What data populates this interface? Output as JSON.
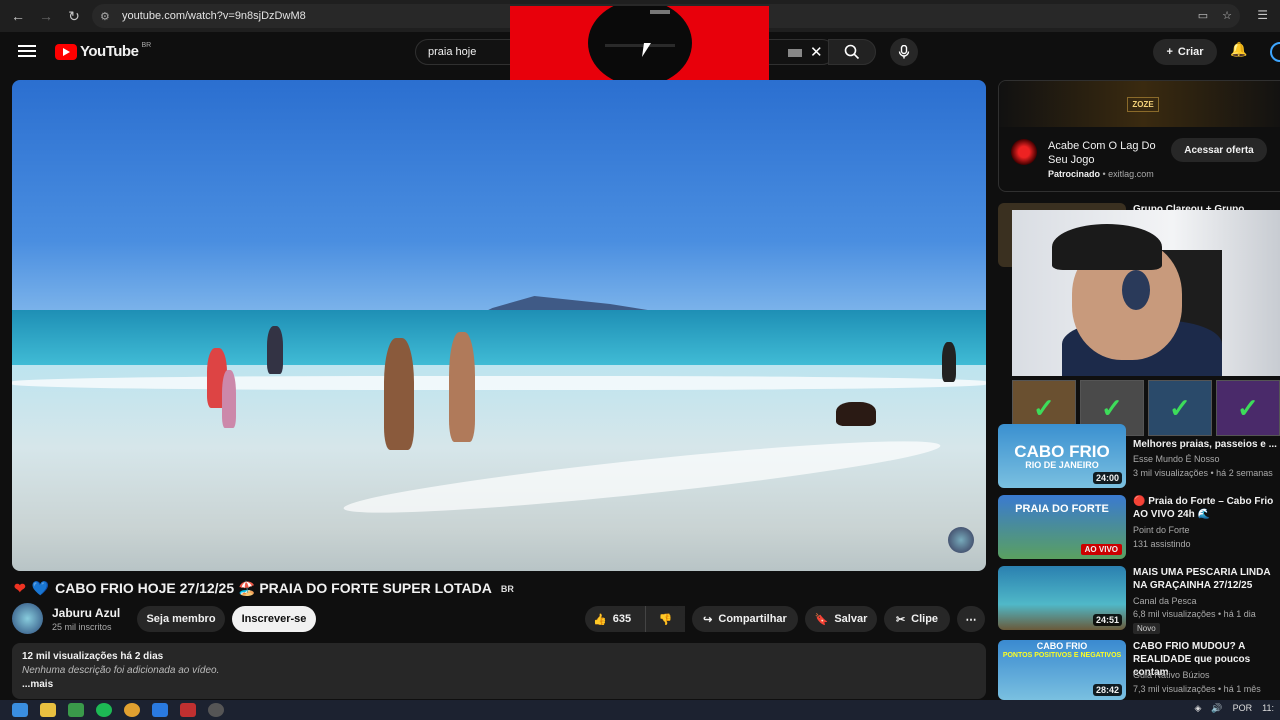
{
  "browser": {
    "url": "youtube.com/watch?v=9n8sjDzDwM8"
  },
  "header": {
    "logo_text": "YouTube",
    "country_code": "BR",
    "search_value": "praia hoje",
    "create_label": "Criar"
  },
  "video": {
    "title": "CABO FRIO HOJE 27/12/25 🏖️ PRAIA DO FORTE SUPER LOTADA",
    "title_suffix": "BR",
    "channel_name": "Jaburu Azul",
    "subscribers": "25 mil inscritos",
    "member_label": "Seja membro",
    "subscribe_label": "Inscrever-se",
    "likes": "635",
    "share_label": "Compartilhar",
    "save_label": "Salvar",
    "clip_label": "Clipe",
    "views_date": "12 mil visualizações  há 2 dias",
    "description": "Nenhuma descrição foi adicionada ao vídeo.",
    "more_label": "...mais"
  },
  "ad": {
    "banner_text": "ZOZE",
    "title": "Acabe Com O Lag Do Seu Jogo",
    "sponsored": "Patrocinado",
    "domain": "exitlag.com",
    "cta": "Acessar oferta"
  },
  "recommendations": [
    {
      "title": "Grupo Clareou + Grupo",
      "channel": "",
      "meta": "",
      "duration": "",
      "thumb_text": "",
      "live": false
    },
    {
      "title": "Melhores praias, passeios e ...",
      "channel": "Esse Mundo É Nosso",
      "meta": "3 mil visualizações • há 2 semanas",
      "duration": "24:00",
      "thumb_text": "CABO FRIO",
      "thumb_sub": "RIO DE JANEIRO",
      "live": false
    },
    {
      "title": "🔴 Praia do Forte – Cabo Frio AO VIVO 24h 🌊",
      "channel": "Point do Forte",
      "meta": "131 assistindo",
      "duration": "AO VIVO",
      "thumb_text": "PRAIA DO FORTE",
      "thumb_sub": "AO VIVO",
      "live": true
    },
    {
      "title": "MAIS UMA PESCARIA LINDA NA GRAÇAINHA 27/12/25",
      "channel": "Canal da Pesca",
      "meta": "6,8 mil visualizações • há 1 dia",
      "duration": "24:51",
      "badge": "Novo",
      "live": false
    },
    {
      "title": "CABO FRIO MUDOU? A REALIDADE que poucos contam",
      "channel": "Guia Nativo Búzios",
      "meta": "7,3 mil visualizações • há 1 mês",
      "duration": "28:42",
      "thumb_text": "CABO FRIO",
      "thumb_sub": "PONTOS POSITIVOS E NEGATIVOS",
      "live": false
    }
  ],
  "taskbar": {
    "lang": "POR",
    "time": "11:"
  }
}
